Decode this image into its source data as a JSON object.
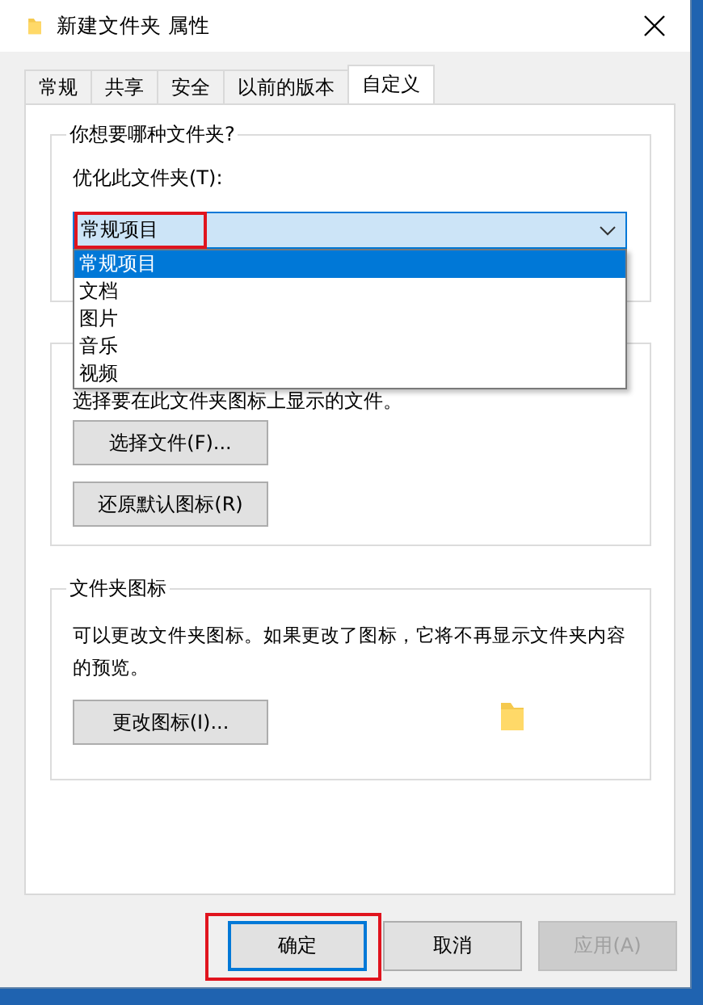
{
  "window": {
    "title": "新建文件夹 属性"
  },
  "tabs": [
    {
      "label": "常规",
      "selected": false
    },
    {
      "label": "共享",
      "selected": false
    },
    {
      "label": "安全",
      "selected": false
    },
    {
      "label": "以前的版本",
      "selected": false
    },
    {
      "label": "自定义",
      "selected": true
    }
  ],
  "optimize_group": {
    "title": "你想要哪种文件夹?",
    "label": "优化此文件夹(T):",
    "dropdown": {
      "value": "常规项目",
      "expanded": true,
      "annotated": true,
      "options": [
        {
          "label": "常规项目",
          "selected": true
        },
        {
          "label": "文档",
          "selected": false
        },
        {
          "label": "图片",
          "selected": false
        },
        {
          "label": "音乐",
          "selected": false
        },
        {
          "label": "视频",
          "selected": false
        }
      ]
    }
  },
  "pictures_group": {
    "description": "选择要在此文件夹图标上显示的文件。",
    "buttons": [
      "选择文件(F)...",
      "还原默认图标(R)"
    ]
  },
  "icon_group": {
    "title": "文件夹图标",
    "description": "可以更改文件夹图标。如果更改了图标，它将不再显示文件夹内容的预览。",
    "button": "更改图标(I)..."
  },
  "dialog_buttons": [
    {
      "label": "确定",
      "default": true,
      "annotated": true,
      "disabled": false
    },
    {
      "label": "取消",
      "default": false,
      "annotated": false,
      "disabled": false
    },
    {
      "label": "应用(A)",
      "default": false,
      "annotated": false,
      "disabled": true
    }
  ]
}
